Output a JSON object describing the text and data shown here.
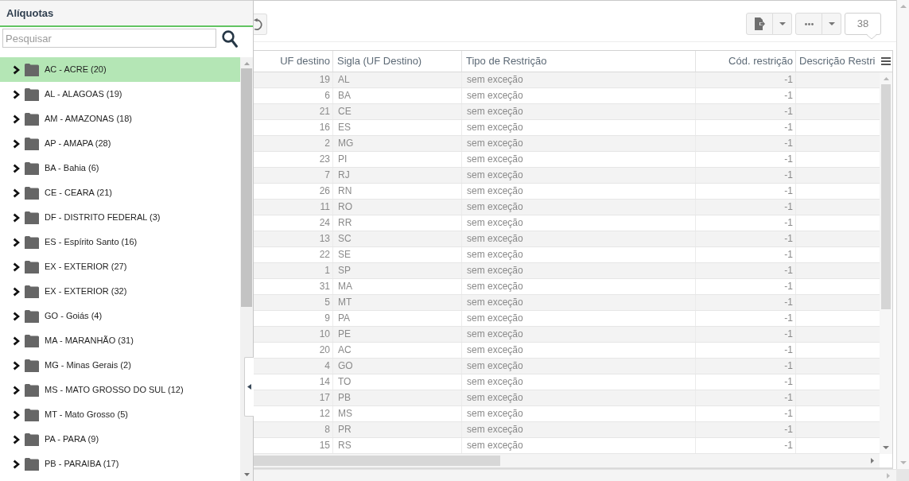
{
  "side_panel": {
    "title": "Alíquotas",
    "search": {
      "placeholder": "Pesquisar"
    },
    "tree": [
      {
        "label": "AC - ACRE (20)",
        "selected": true,
        "expanded": false
      },
      {
        "label": "AL - ALAGOAS (19)",
        "selected": false,
        "expanded": false
      },
      {
        "label": "AM - AMAZONAS (18)",
        "selected": false,
        "expanded": false
      },
      {
        "label": "AP - AMAPA (28)",
        "selected": false,
        "expanded": false
      },
      {
        "label": "BA - Bahia (6)",
        "selected": false,
        "expanded": false
      },
      {
        "label": "CE - CEARA (21)",
        "selected": false,
        "expanded": false
      },
      {
        "label": "DF - DISTRITO FEDERAL (3)",
        "selected": false,
        "expanded": false
      },
      {
        "label": "ES - Espírito Santo (16)",
        "selected": false,
        "expanded": false
      },
      {
        "label": "EX - EXTERIOR (27)",
        "selected": false,
        "expanded": false
      },
      {
        "label": "EX - EXTERIOR (32)",
        "selected": false,
        "expanded": false
      },
      {
        "label": "GO - Goiás (4)",
        "selected": false,
        "expanded": false
      },
      {
        "label": "MA - MARANHÃO (31)",
        "selected": false,
        "expanded": false
      },
      {
        "label": "MG - Minas Gerais (2)",
        "selected": false,
        "expanded": false
      },
      {
        "label": "MS - MATO GROSSO DO SUL (12)",
        "selected": false,
        "expanded": false
      },
      {
        "label": "MT - Mato Grosso (5)",
        "selected": false,
        "expanded": false
      },
      {
        "label": "PA - PARA (9)",
        "selected": false,
        "expanded": false
      },
      {
        "label": "PB - PARAIBA (17)",
        "selected": false,
        "expanded": false
      }
    ]
  },
  "toolbar": {
    "record_count": "38"
  },
  "table": {
    "columns": [
      {
        "label": "UF destino",
        "kind": "number"
      },
      {
        "label": "Sigla (UF Destino)",
        "kind": "text"
      },
      {
        "label": "Tipo de Restrição",
        "kind": "text"
      },
      {
        "label": "Cód. restrição",
        "kind": "number"
      },
      {
        "label": "Descrição Restri",
        "kind": "text"
      }
    ],
    "rows": [
      {
        "cells": [
          "19",
          "AL",
          "sem exceção",
          "-1"
        ]
      },
      {
        "cells": [
          "6",
          "BA",
          "sem exceção",
          "-1"
        ]
      },
      {
        "cells": [
          "21",
          "CE",
          "sem exceção",
          "-1"
        ]
      },
      {
        "cells": [
          "16",
          "ES",
          "sem exceção",
          "-1"
        ]
      },
      {
        "cells": [
          "2",
          "MG",
          "sem exceção",
          "-1"
        ]
      },
      {
        "cells": [
          "23",
          "PI",
          "sem exceção",
          "-1"
        ]
      },
      {
        "cells": [
          "7",
          "RJ",
          "sem exceção",
          "-1"
        ]
      },
      {
        "cells": [
          "26",
          "RN",
          "sem exceção",
          "-1"
        ]
      },
      {
        "cells": [
          "11",
          "RO",
          "sem exceção",
          "-1"
        ]
      },
      {
        "cells": [
          "24",
          "RR",
          "sem exceção",
          "-1"
        ]
      },
      {
        "cells": [
          "13",
          "SC",
          "sem exceção",
          "-1"
        ]
      },
      {
        "cells": [
          "22",
          "SE",
          "sem exceção",
          "-1"
        ]
      },
      {
        "cells": [
          "1",
          "SP",
          "sem exceção",
          "-1"
        ]
      },
      {
        "cells": [
          "31",
          "MA",
          "sem exceção",
          "-1"
        ]
      },
      {
        "cells": [
          "5",
          "MT",
          "sem exceção",
          "-1"
        ]
      },
      {
        "cells": [
          "9",
          "PA",
          "sem exceção",
          "-1"
        ]
      },
      {
        "cells": [
          "10",
          "PE",
          "sem exceção",
          "-1"
        ]
      },
      {
        "cells": [
          "20",
          "AC",
          "sem exceção",
          "-1"
        ]
      },
      {
        "cells": [
          "4",
          "GO",
          "sem exceção",
          "-1"
        ]
      },
      {
        "cells": [
          "14",
          "TO",
          "sem exceção",
          "-1"
        ]
      },
      {
        "cells": [
          "17",
          "PB",
          "sem exceção",
          "-1"
        ]
      },
      {
        "cells": [
          "12",
          "MS",
          "sem exceção",
          "-1"
        ]
      },
      {
        "cells": [
          "8",
          "PR",
          "sem exceção",
          "-1"
        ]
      },
      {
        "cells": [
          "15",
          "RS",
          "sem exceção",
          "-1"
        ]
      }
    ]
  }
}
